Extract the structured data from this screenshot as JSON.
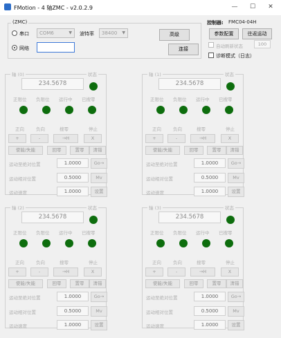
{
  "window": {
    "title": "FMotion - 4 轴ZMC - v2.0.2.9",
    "minimize": "—",
    "maximize": "☐",
    "close": "✕"
  },
  "connection": {
    "group_label": "(ZMC)",
    "serial_label": "串口",
    "com_value": "COM6",
    "baud_label": "波特率",
    "baud_value": "38400",
    "network_label": "网络",
    "ip_value": "",
    "advanced_button": "高级",
    "connect_button": "连接"
  },
  "controller": {
    "label": "控制器:",
    "model": "FMC04-04H",
    "param_config_button": "参数配置",
    "back_zero_button": "往返运动",
    "auto_refresh_label": "自动刷新状态",
    "auto_refresh_value": "100",
    "diag_label": "诊断模式（日志）"
  },
  "axes": [
    {
      "title": "轴 (0)",
      "status_label": "状态",
      "position": "234.5678",
      "limit_pos": "正限位",
      "limit_neg": "负限位",
      "running": "运行中",
      "homed": "已搜零",
      "jog_pos": "正向",
      "jog_neg": "负向",
      "search": "搜零",
      "stop": "停止",
      "btn_pos": "+",
      "btn_neg": "-",
      "btn_search": "→H",
      "btn_stop": "X",
      "enable": "使能/失能",
      "home": "回零",
      "zero": "置零",
      "clear": "清错",
      "abs_label": "运动至绝对位置",
      "abs_value": "1.0000",
      "abs_btn": "Go→",
      "rel_label": "运动相对位置",
      "rel_value": "0.5000",
      "rel_btn": "Mv",
      "speed_label": "运动速度",
      "speed_value": "1.0000",
      "speed_btn": "设置"
    },
    {
      "title": "轴 (1)",
      "status_label": "状态",
      "position": "234.5678",
      "limit_pos": "正限位",
      "limit_neg": "负限位",
      "running": "运行中",
      "homed": "已搜零",
      "jog_pos": "正向",
      "jog_neg": "负向",
      "search": "搜零",
      "stop": "停止",
      "btn_pos": "+",
      "btn_neg": "-",
      "btn_search": "→H",
      "btn_stop": "X",
      "enable": "使能/失能",
      "home": "回零",
      "zero": "置零",
      "clear": "清错",
      "abs_label": "运动至绝对位置",
      "abs_value": "1.0000",
      "abs_btn": "Go→",
      "rel_label": "运动相对位置",
      "rel_value": "0.5000",
      "rel_btn": "Mv",
      "speed_label": "运动速度",
      "speed_value": "1.0000",
      "speed_btn": "设置"
    },
    {
      "title": "轴 (2)",
      "status_label": "状态",
      "position": "234.5678",
      "limit_pos": "正限位",
      "limit_neg": "负限位",
      "running": "运行中",
      "homed": "已搜零",
      "jog_pos": "正向",
      "jog_neg": "负向",
      "search": "搜零",
      "stop": "停止",
      "btn_pos": "+",
      "btn_neg": "-",
      "btn_search": "→H",
      "btn_stop": "X",
      "enable": "使能/失能",
      "home": "回零",
      "zero": "置零",
      "clear": "清错",
      "abs_label": "运动至绝对位置",
      "abs_value": "1.0000",
      "abs_btn": "Go→",
      "rel_label": "运动相对位置",
      "rel_value": "0.5000",
      "rel_btn": "Mv",
      "speed_label": "运动速度",
      "speed_value": "1.0000",
      "speed_btn": "设置"
    },
    {
      "title": "轴 (3)",
      "status_label": "状态",
      "position": "234.5678",
      "limit_pos": "正限位",
      "limit_neg": "负限位",
      "running": "运行中",
      "homed": "已搜零",
      "jog_pos": "正向",
      "jog_neg": "负向",
      "search": "搜零",
      "stop": "停止",
      "btn_pos": "+",
      "btn_neg": "-",
      "btn_search": "→H",
      "btn_stop": "X",
      "enable": "使能/失能",
      "home": "回零",
      "zero": "置零",
      "clear": "清错",
      "abs_label": "运动至绝对位置",
      "abs_value": "1.0000",
      "abs_btn": "Go→",
      "rel_label": "运动相对位置",
      "rel_value": "0.5000",
      "rel_btn": "Mv",
      "speed_label": "运动速度",
      "speed_value": "1.0000",
      "speed_btn": "设置"
    }
  ]
}
